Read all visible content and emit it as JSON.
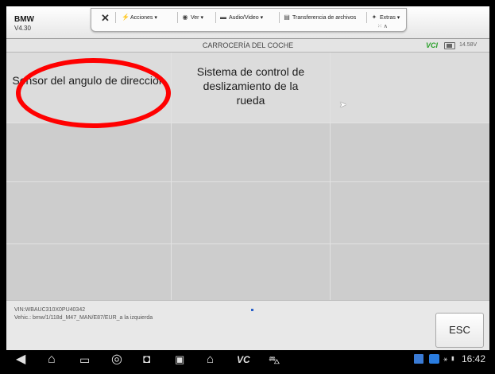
{
  "header": {
    "app_name": "BMW",
    "version": "V4.30"
  },
  "remote_toolbar": {
    "items": [
      {
        "label": "Acciones",
        "icon": "lightning-icon",
        "icon_glyph": "⚡"
      },
      {
        "label": "Ver",
        "icon": "eye-icon",
        "icon_glyph": "◉"
      },
      {
        "label": "Audio/Video",
        "icon": "chat-icon",
        "icon_glyph": "▬"
      },
      {
        "label": "Transferencia de archivos",
        "icon": "file-icon",
        "icon_glyph": "▤"
      },
      {
        "label": "Extras",
        "icon": "sparkle-icon",
        "icon_glyph": "✦"
      }
    ]
  },
  "title_bar": {
    "title": "CARROCERÍA DEL COCHE",
    "vci": "VCI",
    "battery_voltage": "14.58V"
  },
  "grid": {
    "cells": [
      {
        "label": "Sensor del angulo de dirección"
      },
      {
        "label": "Sistema de control de deslizamiento de la rueda"
      },
      {
        "label": ""
      },
      {
        "label": ""
      },
      {
        "label": ""
      },
      {
        "label": ""
      },
      {
        "label": ""
      },
      {
        "label": ""
      },
      {
        "label": ""
      },
      {
        "label": ""
      },
      {
        "label": ""
      },
      {
        "label": ""
      }
    ]
  },
  "footer": {
    "vin": "VIN:WBAUC310X0PU40342",
    "vehicle": "Vehic.: bmw/1/118d_M47_MAN/E87/EUR_a la izquierda",
    "esc_label": "ESC"
  },
  "navbar": {
    "time": "16:42",
    "vc_label": "VC"
  },
  "colors": {
    "annotation_red": "#ff0000",
    "cell_bg": "#dcdcdc",
    "accent_green": "#2aa02a"
  }
}
